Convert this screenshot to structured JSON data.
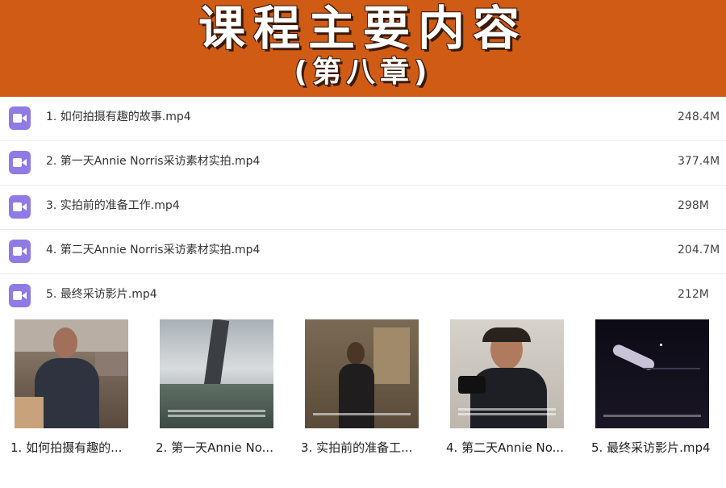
{
  "banner": {
    "title": "课程主要内容",
    "subtitle": "(第八章)"
  },
  "colors": {
    "banner_bg": "#cf5b15",
    "video_icon": "#8f7ae6"
  },
  "files": [
    {
      "name": "1. 如何拍摄有趣的故事.mp4",
      "size": "248.4M",
      "icon": "video-file-icon"
    },
    {
      "name": "2. 第一天Annie Norris采访素材实拍.mp4",
      "size": "377.4M",
      "icon": "video-file-icon"
    },
    {
      "name": "3. 实拍前的准备工作.mp4",
      "size": "298M",
      "icon": "video-file-icon"
    },
    {
      "name": "4. 第二天Annie Norris采访素材实拍.mp4",
      "size": "204.7M",
      "icon": "video-file-icon"
    },
    {
      "name": "5. 最终采访影片.mp4",
      "size": "212M",
      "icon": "video-file-icon"
    }
  ],
  "thumbnails": [
    {
      "caption": "1. 如何拍摄有趣的..."
    },
    {
      "caption": "2. 第一天Annie No..."
    },
    {
      "caption": "3. 实拍前的准备工..."
    },
    {
      "caption": "4. 第二天Annie No..."
    },
    {
      "caption": "5. 最终采访影片.mp4"
    }
  ]
}
